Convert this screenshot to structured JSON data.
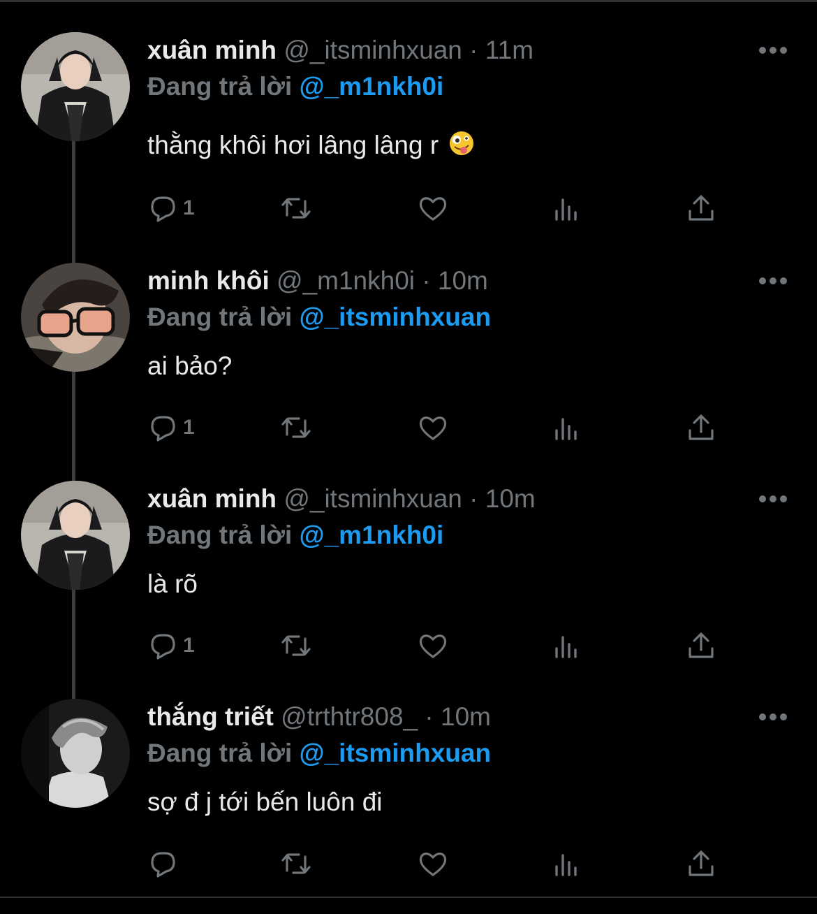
{
  "thread": [
    {
      "display_name": "xuân minh",
      "handle": "@_itsminhxuan",
      "separator": "·",
      "time": "11m",
      "reply_prefix": "Đang trả lời",
      "reply_to": "@_m1nkh0i",
      "text": "thằng khôi hơi lâng lâng r",
      "emoji": "zany-face-emoji",
      "reply_count": "1",
      "avatar": "avatar-photo"
    },
    {
      "display_name": "minh khôi",
      "handle": "@_m1nkh0i",
      "separator": "·",
      "time": "10m",
      "reply_prefix": "Đang trả lời",
      "reply_to": "@_itsminhxuan",
      "text": "ai bảo?",
      "reply_count": "1",
      "avatar": "avatar-photo"
    },
    {
      "display_name": "xuân minh",
      "handle": "@_itsminhxuan",
      "separator": "·",
      "time": "10m",
      "reply_prefix": "Đang trả lời",
      "reply_to": "@_m1nkh0i",
      "text": "là rõ",
      "reply_count": "1",
      "avatar": "avatar-photo"
    },
    {
      "display_name": "thắng triết",
      "handle": "@trthtr808_",
      "separator": "·",
      "time": "10m",
      "reply_prefix": "Đang trả lời",
      "reply_to": "@_itsminhxuan",
      "text": "sợ đ j tới bến luôn đi",
      "reply_count": "",
      "avatar": "avatar-photo"
    }
  ],
  "icons": {
    "reply": "reply-icon",
    "retweet": "retweet-icon",
    "like": "heart-icon",
    "views": "views-icon",
    "share": "share-icon",
    "more": "more-icon"
  },
  "colors": {
    "background": "#000000",
    "primary_text": "#e7e9ea",
    "secondary_text": "#71767b",
    "mention": "#1d9bf0",
    "thread_line": "#3a3d40"
  }
}
